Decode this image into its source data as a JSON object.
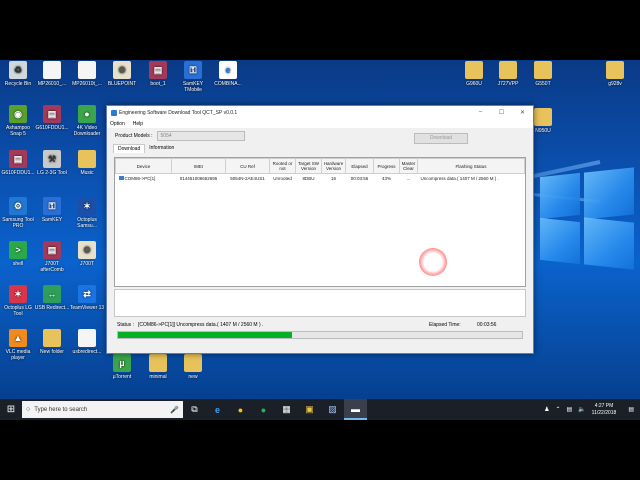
{
  "desktop_icons": [
    {
      "label": "Recycle Bin",
      "glyph": "♻",
      "bg": "#cfd8dc",
      "fg": "#333"
    },
    {
      "label": "MP26010_...",
      "glyph": "",
      "bg": "#f5f5f5",
      "fg": "#333"
    },
    {
      "label": "MP26010t_...",
      "glyph": "",
      "bg": "#f5f5f5",
      "fg": "#333"
    },
    {
      "label": "BLUEPOINT",
      "glyph": "⚙",
      "bg": "#e8e0c8",
      "fg": "#555"
    },
    {
      "label": "boot_1",
      "glyph": "▤",
      "bg": "#a33a5a",
      "fg": "#fff"
    },
    {
      "label": "SamKEY TMobile",
      "glyph": "⚿",
      "bg": "#2a6fd6",
      "fg": "#fff"
    },
    {
      "label": "COMBINA...",
      "glyph": "e",
      "bg": "#ffffff",
      "fg": "#1e7ad6"
    },
    {
      "label": "Ashampoo Snap 5",
      "glyph": "◉",
      "bg": "#5aa02c",
      "fg": "#fff"
    },
    {
      "label": "G610FDDU1...",
      "glyph": "▤",
      "bg": "#a33a5a",
      "fg": "#fff"
    },
    {
      "label": "4K Video Downloader",
      "glyph": "●",
      "bg": "#3aa54b",
      "fg": "#fff"
    },
    {
      "label": "G610FDDU1...",
      "glyph": "▤",
      "bg": "#a33a5a",
      "fg": "#fff"
    },
    {
      "label": "LG 2-3G Tool",
      "glyph": "⚒",
      "bg": "#c9c9c9",
      "fg": "#333"
    },
    {
      "label": "Music",
      "glyph": "",
      "bg": "#e8c25a",
      "fg": "#333"
    },
    {
      "label": "Samsung Tool PRO",
      "glyph": "⚙",
      "bg": "#1f78d1",
      "fg": "#fff"
    },
    {
      "label": "SamKEY",
      "glyph": "⚿",
      "bg": "#2a6fd6",
      "fg": "#fff"
    },
    {
      "label": "Octoplus Samsu...",
      "glyph": "✶",
      "bg": "#1b4fa8",
      "fg": "#fff"
    },
    {
      "label": "shell",
      "glyph": ">",
      "bg": "#2aa84a",
      "fg": "#fff"
    },
    {
      "label": "J700T afterComb",
      "glyph": "▤",
      "bg": "#a33a5a",
      "fg": "#fff"
    },
    {
      "label": "J700T",
      "glyph": "⚙",
      "bg": "#e8e0c8",
      "fg": "#555"
    },
    {
      "label": "Octoplus LG Tool",
      "glyph": "✶",
      "bg": "#d8344a",
      "fg": "#fff"
    },
    {
      "label": "USB Redirect...",
      "glyph": "↔",
      "bg": "#2f9e5a",
      "fg": "#fff"
    },
    {
      "label": "TeamViewer 13",
      "glyph": "⇄",
      "bg": "#1b74e4",
      "fg": "#fff"
    },
    {
      "label": "VLC media player",
      "glyph": "▲",
      "bg": "#f08a1c",
      "fg": "#fff"
    },
    {
      "label": "New folder",
      "glyph": "",
      "bg": "#e8c25a",
      "fg": "#333"
    },
    {
      "label": "usbredirect...",
      "glyph": "",
      "bg": "#f5f5f5",
      "fg": "#333"
    },
    {
      "label": "µTorrent",
      "glyph": "µ",
      "bg": "#3aa54b",
      "fg": "#fff"
    },
    {
      "label": "minimal",
      "glyph": "",
      "bg": "#e8c25a",
      "fg": "#333"
    },
    {
      "label": "new",
      "glyph": "",
      "bg": "#e8c25a",
      "fg": "#333"
    },
    {
      "label": "G960U",
      "glyph": "",
      "bg": "#e8c25a",
      "fg": "#333"
    },
    {
      "label": "J727VPP",
      "glyph": "",
      "bg": "#e8c25a",
      "fg": "#333"
    },
    {
      "label": "G550T",
      "glyph": "",
      "bg": "#e8c25a",
      "fg": "#333"
    },
    {
      "label": "g928v",
      "glyph": "",
      "bg": "#e8c25a",
      "fg": "#333"
    },
    {
      "label": "N950U",
      "glyph": "",
      "bg": "#e8c25a",
      "fg": "#333"
    }
  ],
  "app": {
    "title": "Engineering Software Download Tool QCT_SP v0.0.1",
    "menu": [
      "Option",
      "Help"
    ],
    "model_label": "Product Models :",
    "model_value": "5054",
    "download_button": "Download",
    "tabs": [
      "Download",
      "Information"
    ],
    "columns": [
      "Device",
      "IMEI",
      "CU Ref",
      "Rooted or not",
      "Target SW Version",
      "Hardware Version",
      "Elapsed",
      "Progress",
      "Master Clear",
      "Flashing Status"
    ],
    "rows": [
      [
        "COM86->PC[1]",
        "014451006662695",
        "5054N-2AE4US1",
        "Unrooted",
        "8DBU",
        "16",
        "00:03:56",
        "43%",
        "...",
        "Uncompress data.( 1407 M / 2560 M ) ."
      ]
    ],
    "status_label": "Status :",
    "status_text": "[COM86->PC[1]] Uncompress data.( 1407 M / 2560 M ) .",
    "elapsed_label": "Elapsed Time:",
    "elapsed_value": "00:03:56",
    "progress_fraction": 0.43
  },
  "taskbar": {
    "search_placeholder": "Type here to search",
    "time": "4:27 PM",
    "date": "11/22/2018"
  }
}
